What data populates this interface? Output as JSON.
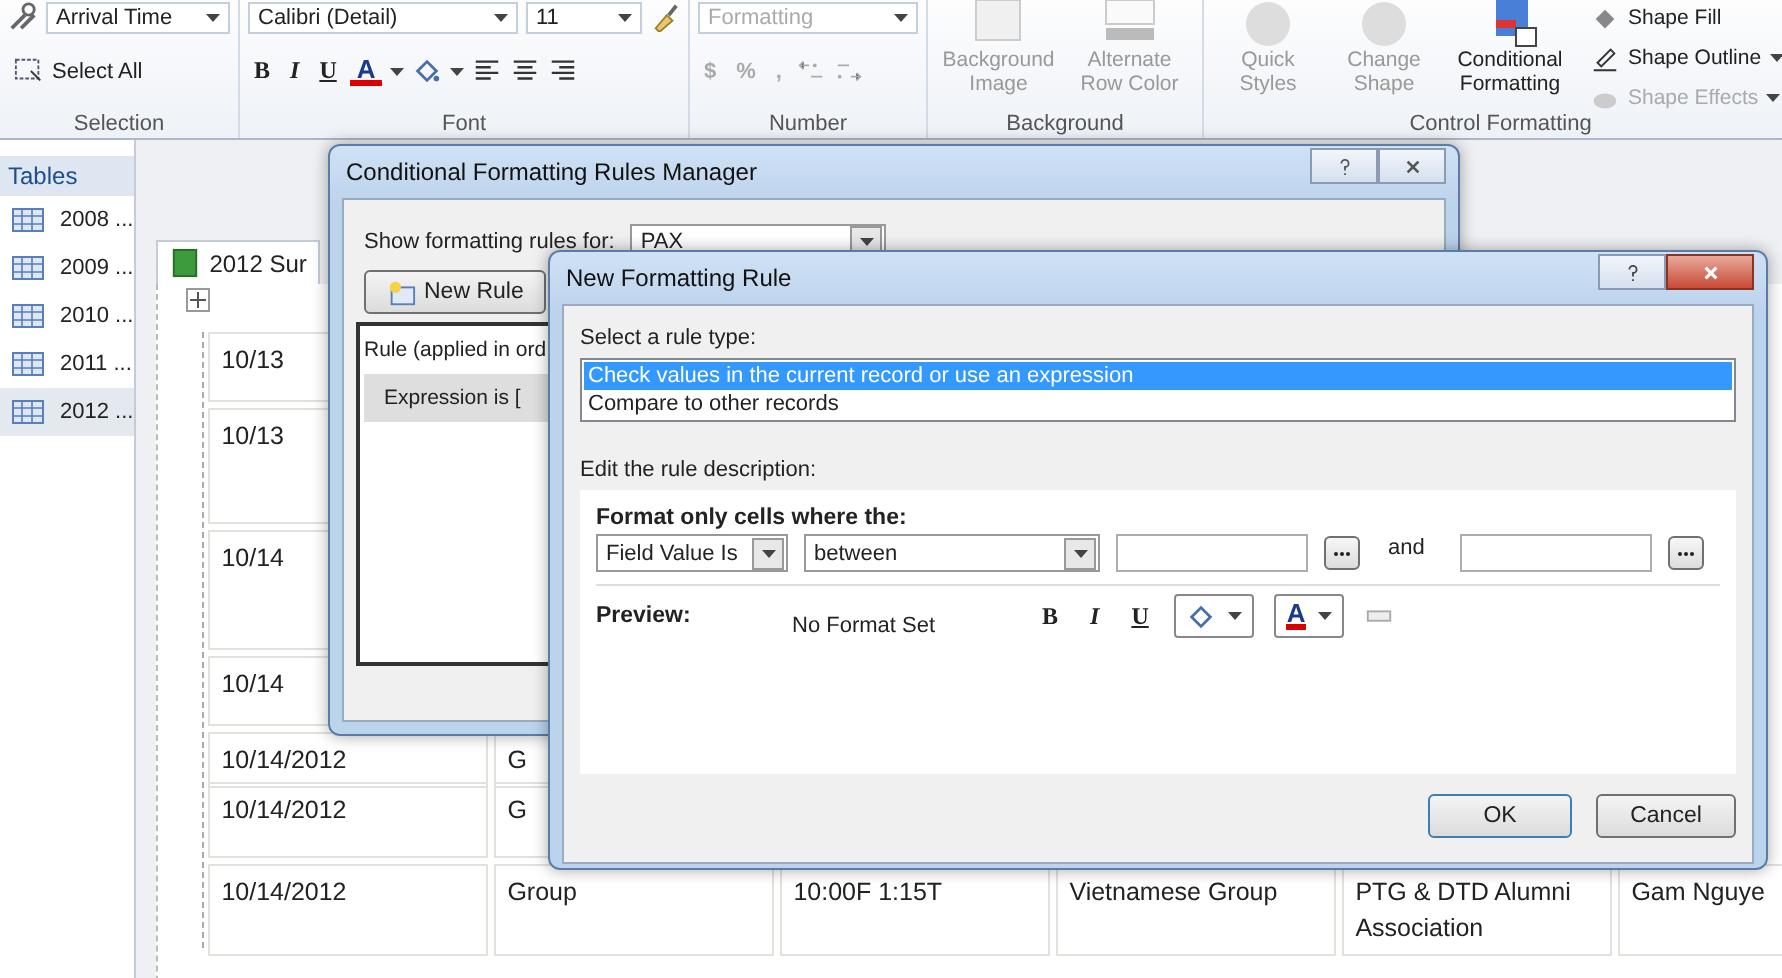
{
  "ribbon": {
    "selection": {
      "object_dropdown": "Arrival Time",
      "select_all": "Select All",
      "label": "Selection"
    },
    "font": {
      "font_name": "Calibri (Detail)",
      "font_size": "11",
      "style_buttons": [
        "B",
        "I",
        "U"
      ],
      "font_color_glyph": "A",
      "label": "Font"
    },
    "number": {
      "format_dropdown": "Formatting",
      "disabled": true,
      "buttons": [
        "$",
        "%",
        ","
      ],
      "label": "Number"
    },
    "background": {
      "buttons": [
        {
          "label": "Background Image",
          "disabled": true
        },
        {
          "label": "Alternate Row Color",
          "disabled": true
        }
      ],
      "label": "Background"
    },
    "control_formatting": {
      "buttons": [
        {
          "label": "Quick Styles",
          "disabled": true
        },
        {
          "label": "Change Shape",
          "disabled": true
        },
        {
          "label": "Conditional Formatting",
          "disabled": false
        }
      ],
      "shape_commands": [
        {
          "label": "Shape Fill",
          "disabled": false
        },
        {
          "label": "Shape Outline",
          "disabled": false
        },
        {
          "label": "Shape Effects",
          "disabled": true
        }
      ],
      "label": "Control Formatting"
    }
  },
  "nav": {
    "header": "Tables",
    "items": [
      {
        "label": "2008 ...",
        "selected": false
      },
      {
        "label": "2009 ...",
        "selected": false
      },
      {
        "label": "2010 ...",
        "selected": false
      },
      {
        "label": "2011 ...",
        "selected": false
      },
      {
        "label": "2012 ...",
        "selected": true
      }
    ]
  },
  "report": {
    "tab": "2012 Sur",
    "rows": [
      {
        "cells": [
          "10/13"
        ]
      },
      {
        "cells": [
          "10/13"
        ]
      },
      {
        "cells": [
          "10/14"
        ]
      },
      {
        "cells": [
          "10/14"
        ]
      },
      {
        "cells": [
          "10/14/2012",
          "G"
        ]
      },
      {
        "cells": [
          "10/14/2012",
          "G"
        ]
      },
      {
        "cells": [
          "10/14/2012",
          "Group",
          "10:00F  1:15T",
          "Vietnamese Group",
          "PTG & DTD Alumni Association",
          "Gam Nguye"
        ]
      }
    ]
  },
  "rules_manager": {
    "title": "Conditional Formatting Rules Manager",
    "show_label": "Show formatting rules for:",
    "show_value": "PAX",
    "new_rule": "New Rule",
    "list_header": "Rule (applied in ord",
    "rules": [
      {
        "text": "Expression is [",
        "selected": true
      }
    ]
  },
  "new_rule_dialog": {
    "title": "New Formatting Rule",
    "rule_type_label": "Select a rule type:",
    "rule_types": [
      {
        "label": "Check values in the current record or use an expression",
        "selected": true
      },
      {
        "label": "Compare to other records",
        "selected": false
      }
    ],
    "description_label": "Edit the rule description:",
    "condition_heading": "Format only cells where the:",
    "field_dropdown": "Field Value Is",
    "operator_dropdown": "between",
    "and_label": "and",
    "preview_label": "Preview:",
    "preview_text": "No Format Set",
    "style_buttons": [
      "B",
      "I",
      "U"
    ],
    "font_color_glyph": "A",
    "ok": "OK",
    "cancel": "Cancel"
  }
}
